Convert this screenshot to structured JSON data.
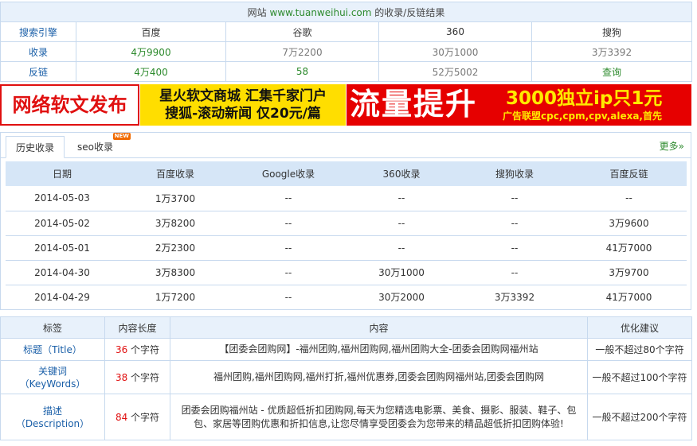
{
  "summary": {
    "title_prefix": "网站",
    "domain": "www.tuanweihui.com",
    "title_suffix": "的收录/反链结果",
    "headers": [
      "搜索引擎",
      "百度",
      "谷歌",
      "360",
      "搜狗"
    ],
    "rows": [
      {
        "label": "收录",
        "values": [
          "4万9900",
          "7万2200",
          "30万1000",
          "3万3392"
        ]
      },
      {
        "label": "反链",
        "values": [
          "4万400",
          "58",
          "52万5002",
          "查询"
        ]
      }
    ]
  },
  "ads": {
    "ad1": "网络软文发布",
    "ad2_line1": "星火软文商城 汇集千家门户",
    "ad2_line2": "搜狐-滚动新闻 仅20元/篇",
    "ad3_big": "流量提升",
    "ad3_right1": "3000独立ip只1元",
    "ad3_right2": "广告联盟cpc,cpm,cpv,alexa,首先"
  },
  "history": {
    "tab_active": "历史收录",
    "tab_other": "seo收录",
    "badge": "NEW",
    "more": "更多»",
    "headers": [
      "日期",
      "百度收录",
      "Google收录",
      "360收录",
      "搜狗收录",
      "百度反链"
    ],
    "rows": [
      [
        "2014-05-03",
        "1万3700",
        "--",
        "--",
        "--",
        "--"
      ],
      [
        "2014-05-02",
        "3万8200",
        "--",
        "--",
        "--",
        "3万9600"
      ],
      [
        "2014-05-01",
        "2万2300",
        "--",
        "--",
        "--",
        "41万7000"
      ],
      [
        "2014-04-30",
        "3万8300",
        "--",
        "30万1000",
        "--",
        "3万9700"
      ],
      [
        "2014-04-29",
        "1万7200",
        "--",
        "30万2000",
        "3万3392",
        "41万7000"
      ]
    ]
  },
  "seo": {
    "headers": [
      "标签",
      "内容长度",
      "内容",
      "优化建议"
    ],
    "unit": "个字符",
    "rows": [
      {
        "label1": "标题（Title）",
        "label2": "",
        "length": "36",
        "content": "【团委会团购网】-福州团购,福州团购网,福州团购大全-团委会团购网福州站",
        "advice": "一般不超过80个字符"
      },
      {
        "label1": "关键词",
        "label2": "（KeyWords）",
        "length": "38",
        "content": "福州团购,福州团购网,福州打折,福州优惠券,团委会团购网福州站,团委会团购网",
        "advice": "一般不超过100个字符"
      },
      {
        "label1": "描述",
        "label2": "（Description）",
        "length": "84",
        "content": "团委会团购福州站 - 优质超低折扣团购网,每天为您精选电影票、美食、摄影、服装、鞋子、包包、家居等团购优惠和折扣信息,让您尽情享受团委会为您带来的精品超低折扣团购体验!",
        "advice": "一般不超过200个字符"
      }
    ]
  }
}
